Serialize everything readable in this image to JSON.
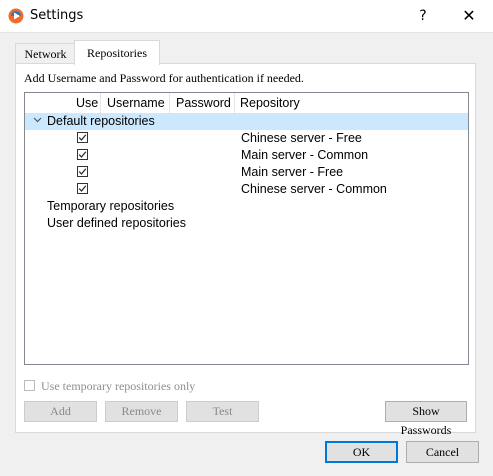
{
  "window": {
    "title": "Settings",
    "help_glyph": "?",
    "close_glyph": "✕"
  },
  "tabs": [
    {
      "label": "Network",
      "active": false
    },
    {
      "label": "Repositories",
      "active": true
    }
  ],
  "panel": {
    "hint": "Add Username and Password for authentication if needed.",
    "columns": [
      "Use",
      "Username",
      "Password",
      "Repository"
    ],
    "categories": [
      {
        "label": "Default repositories",
        "expanded": true,
        "selected": true,
        "repositories": [
          {
            "use": true,
            "username": "",
            "password": "",
            "name": "Chinese server - Free"
          },
          {
            "use": true,
            "username": "",
            "password": "",
            "name": "Main server - Common"
          },
          {
            "use": true,
            "username": "",
            "password": "",
            "name": "Main server - Free"
          },
          {
            "use": true,
            "username": "",
            "password": "",
            "name": "Chinese server - Common"
          }
        ]
      },
      {
        "label": "Temporary repositories",
        "expanded": false,
        "selected": false
      },
      {
        "label": "User defined repositories",
        "expanded": false,
        "selected": false
      }
    ],
    "option_temp_only": {
      "label": "Use temporary repositories only",
      "checked": false,
      "enabled": false
    },
    "buttons": {
      "add": "Add",
      "remove": "Remove",
      "test": "Test",
      "show_passwords": "Show Passwords"
    }
  },
  "footer": {
    "ok": "OK",
    "cancel": "Cancel"
  },
  "colors": {
    "selection": "#cce8ff",
    "default_button_border": "#0078d7",
    "dialog_bg": "#f0f0f0"
  }
}
